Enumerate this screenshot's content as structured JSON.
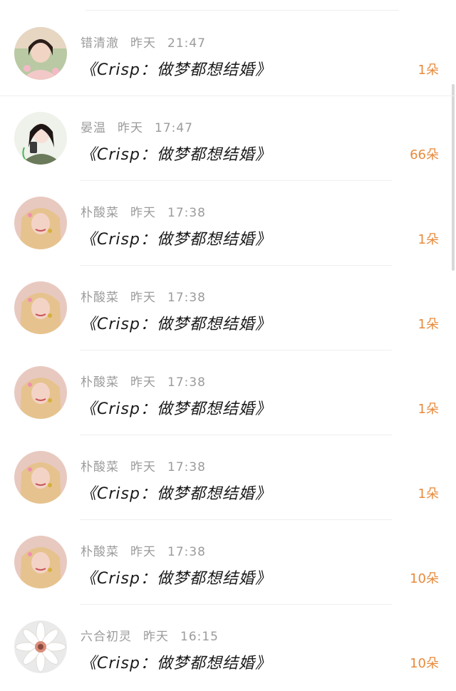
{
  "comments": [
    {
      "user": "错清澈",
      "day": "昨天",
      "time": "21:47",
      "title": "《Crisp：做梦都想结婚》",
      "count": "1朵",
      "avatar": "avatar-girl-blossom"
    },
    {
      "user": "晏温",
      "day": "昨天",
      "time": "17:47",
      "title": "《Crisp：做梦都想结婚》",
      "count": "66朵",
      "avatar": "avatar-girl-phone"
    },
    {
      "user": "朴酸菜",
      "day": "昨天",
      "time": "17:38",
      "title": "《Crisp：做梦都想结婚》",
      "count": "1朵",
      "avatar": "avatar-blonde-girl"
    },
    {
      "user": "朴酸菜",
      "day": "昨天",
      "time": "17:38",
      "title": "《Crisp：做梦都想结婚》",
      "count": "1朵",
      "avatar": "avatar-blonde-girl"
    },
    {
      "user": "朴酸菜",
      "day": "昨天",
      "time": "17:38",
      "title": "《Crisp：做梦都想结婚》",
      "count": "1朵",
      "avatar": "avatar-blonde-girl"
    },
    {
      "user": "朴酸菜",
      "day": "昨天",
      "time": "17:38",
      "title": "《Crisp：做梦都想结婚》",
      "count": "1朵",
      "avatar": "avatar-blonde-girl"
    },
    {
      "user": "朴酸菜",
      "day": "昨天",
      "time": "17:38",
      "title": "《Crisp：做梦都想结婚》",
      "count": "10朵",
      "avatar": "avatar-blonde-girl"
    },
    {
      "user": "六合初灵",
      "day": "昨天",
      "time": "16:15",
      "title": "《Crisp：做梦都想结婚》",
      "count": "10朵",
      "avatar": "avatar-white-flower"
    }
  ],
  "colors": {
    "count": "#e88a3c",
    "meta": "#9b9b9b",
    "title": "#1a1a1a"
  }
}
